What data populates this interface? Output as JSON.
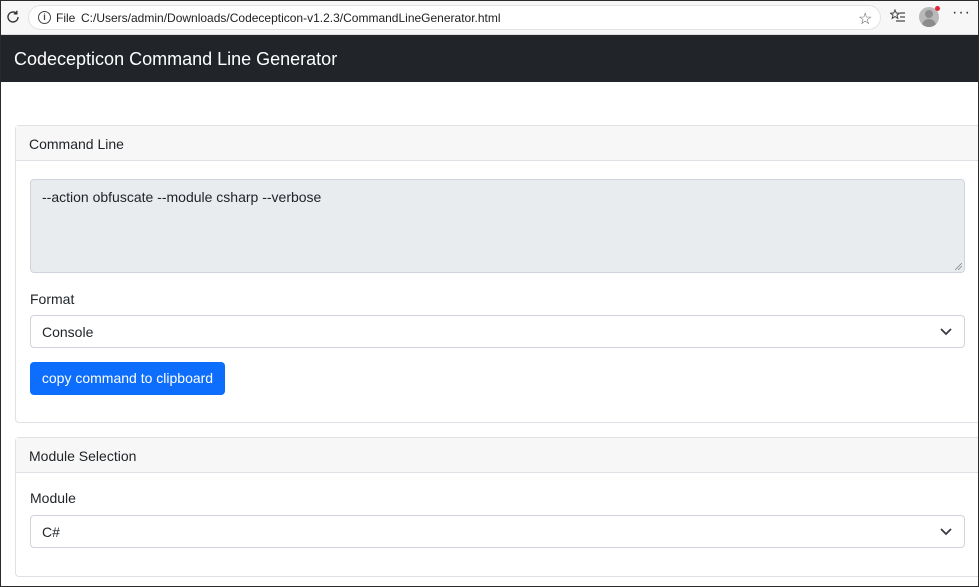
{
  "browser": {
    "file_label": "File",
    "url": "C:/Users/admin/Downloads/Codecepticon-v1.2.3/CommandLineGenerator.html",
    "more_glyph": "···"
  },
  "navbar": {
    "brand": "Codecepticon Command Line Generator"
  },
  "command_card": {
    "header": "Command Line",
    "command_text": "--action obfuscate --module csharp --verbose",
    "format_label": "Format",
    "format_selected": "Console",
    "copy_button": "copy command to clipboard"
  },
  "module_card": {
    "header": "Module Selection",
    "module_label": "Module",
    "module_selected": "C#"
  },
  "colors": {
    "navbar_bg": "#212529",
    "button_bg": "#0d6efd",
    "textarea_bg": "#e9ecef"
  }
}
